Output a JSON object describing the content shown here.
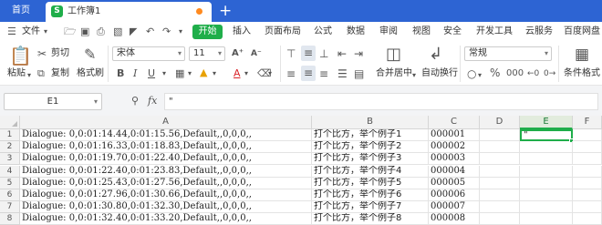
{
  "titlebar": {
    "home_tab": "首页",
    "doc_tab_icon": "S",
    "doc_tab_title": "工作簿1",
    "new_tab": "+",
    "accent": "#2d64d3"
  },
  "menubar": {
    "file_menu": "文件",
    "start": "开始",
    "items": [
      "插入",
      "页面布局",
      "公式",
      "数据",
      "审阅",
      "视图",
      "安全",
      "开发工具",
      "云服务",
      "百度网盘"
    ]
  },
  "ribbon": {
    "paste": "粘贴",
    "cut": "剪切",
    "copy": "复制",
    "format_painter": "格式刷",
    "font_name": "宋体",
    "font_size": "11",
    "merge_center": "合并居中",
    "wrap_text": "自动换行",
    "number_format": "常规",
    "conditional_format": "条件格式"
  },
  "formula_bar": {
    "name_box": "E1",
    "fx": "fx",
    "value": "\""
  },
  "sheet": {
    "columns": [
      "A",
      "B",
      "C",
      "D",
      "E",
      "F"
    ],
    "active_column": "E",
    "active_cell": "E1",
    "rows": [
      {
        "num": "1",
        "a": "Dialogue: 0,0:01:14.44,0:01:15.56,Default,,0,0,0,,",
        "b": "打个比方，举个例子1",
        "c": "000001",
        "e": "\""
      },
      {
        "num": "2",
        "a": "Dialogue: 0,0:01:16.33,0:01:18.83,Default,,0,0,0,,",
        "b": "打个比方，举个例子2",
        "c": "000002",
        "e": ""
      },
      {
        "num": "3",
        "a": "Dialogue: 0,0:01:19.70,0:01:22.40,Default,,0,0,0,,",
        "b": "打个比方，举个例子3",
        "c": "000003",
        "e": ""
      },
      {
        "num": "4",
        "a": "Dialogue: 0,0:01:22.40,0:01:23.83,Default,,0,0,0,,",
        "b": "打个比方，举个例子4",
        "c": "000004",
        "e": ""
      },
      {
        "num": "5",
        "a": "Dialogue: 0,0:01:25.43,0:01:27.56,Default,,0,0,0,,",
        "b": "打个比方，举个例子5",
        "c": "000005",
        "e": ""
      },
      {
        "num": "6",
        "a": "Dialogue: 0,0:01:27.96,0:01:30.66,Default,,0,0,0,,",
        "b": "打个比方，举个例子6",
        "c": "000006",
        "e": ""
      },
      {
        "num": "7",
        "a": "Dialogue: 0,0:01:30.80,0:01:32.30,Default,,0,0,0,,",
        "b": "打个比方，举个例子7",
        "c": "000007",
        "e": ""
      },
      {
        "num": "8",
        "a": "Dialogue: 0,0:01:32.40,0:01:33.20,Default,,0,0,0,,",
        "b": "打个比方，举个例子8",
        "c": "000008",
        "e": ""
      }
    ]
  }
}
